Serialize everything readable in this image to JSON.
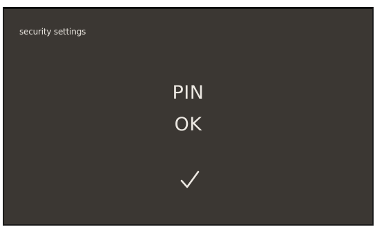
{
  "screen": {
    "title": "security settings",
    "status_line1": "PIN",
    "status_line2": "OK",
    "confirm_icon": "checkmark-icon"
  },
  "colors": {
    "background": "#3b3733",
    "text": "#ece8e2",
    "frame": "#111111"
  }
}
